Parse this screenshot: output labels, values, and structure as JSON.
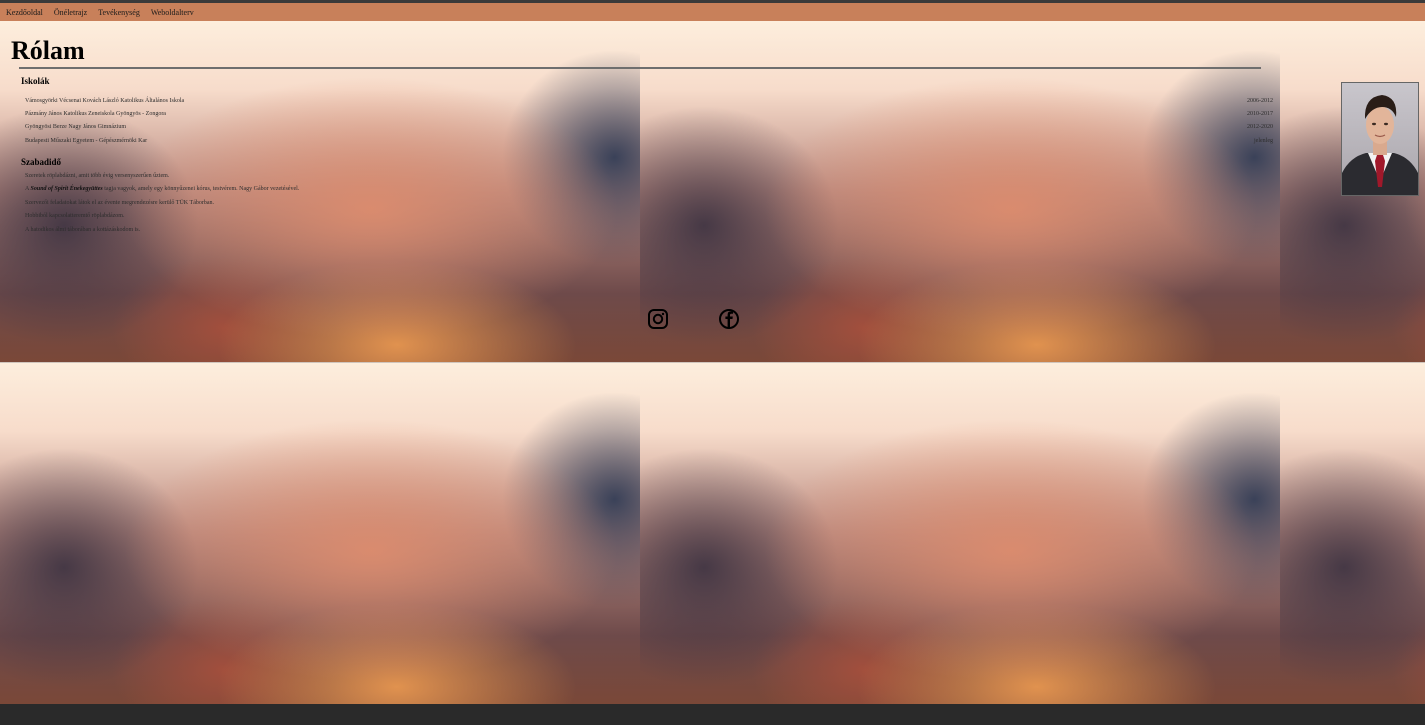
{
  "nav": {
    "items": [
      "Kezdőoldal",
      "Önéletrajz",
      "Tevékenység",
      "Weboldalterv"
    ]
  },
  "page": {
    "title": "Rólam"
  },
  "schools": {
    "heading": "Iskolák",
    "rows": [
      {
        "name": "Vámosgyörki Vécsenai Kovách László Katolikus Általános Iskola",
        "years": "2006-2012"
      },
      {
        "name": "Pázmány János Katolikus Zeneiskola Gyöngyös - Zongora",
        "years": "2010-2017"
      },
      {
        "name": "Gyöngyösi Berze Nagy János Gimnázium",
        "years": "2012-2020"
      },
      {
        "name": "Budapesti Műszaki Egyetem - Gépészmérnöki Kar",
        "years": "jelenleg"
      }
    ]
  },
  "free_time": {
    "heading": "Szabadidő",
    "line1": "Szeretek röplabdázni, amit több évig versenyszerűen űztem.",
    "line2_prefix": "A ",
    "line2_band": "Sound of Spirit Énekegyüttes",
    "line2_suffix": " tagja vagyok, amely egy könnyűzenei kórus, testvérem. Nagy Gábor vezetésével.",
    "line3": "Szervezői feladatokat látok el az évente megrendezésre kerülő TÜK Táborban.",
    "line4": "Hobbiból kapcsolatteremtő röplabdázom.",
    "line5": "A hatodikos álmi táborában a kottázáskodom is."
  },
  "social": {
    "instagram": "instagram-icon",
    "facebook": "facebook-icon"
  },
  "colors": {
    "nav_bg": "#c8805a",
    "rule": "#6e6e6e"
  }
}
